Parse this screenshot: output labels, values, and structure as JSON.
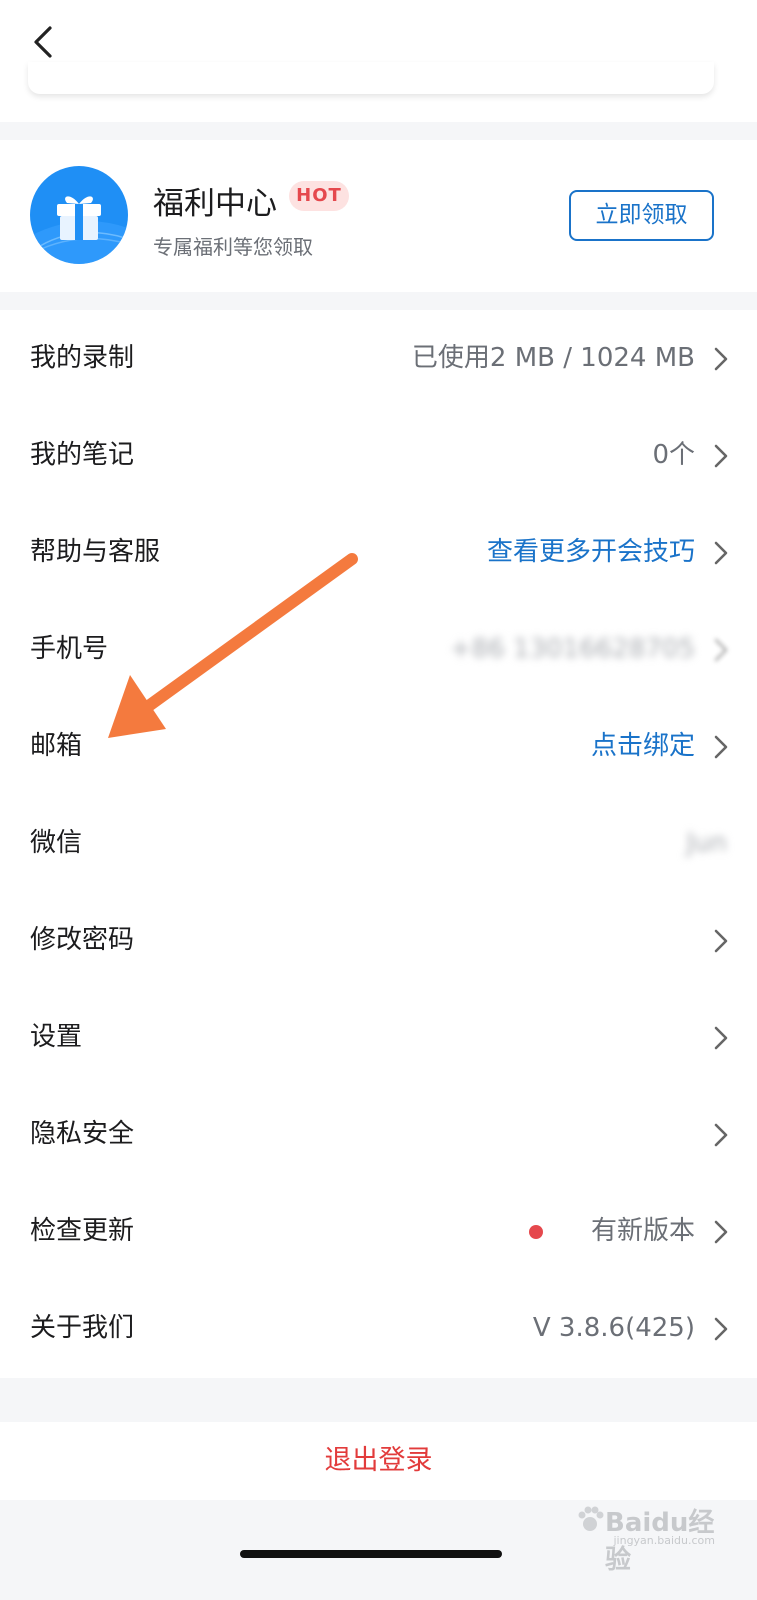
{
  "header": {
    "back_icon": "chevron-left-icon"
  },
  "welfare": {
    "icon": "gift-icon",
    "title": "福利中心",
    "badge": "HOT",
    "subtitle": "专属福利等您领取",
    "button_label": "立即领取",
    "accent_color": "#1a73c9",
    "badge_color": "#e5484d"
  },
  "menu": {
    "items": [
      {
        "label": "我的录制",
        "value": "已使用2 MB / 1024 MB",
        "style": "gray"
      },
      {
        "label": "我的笔记",
        "value": "0个",
        "style": "gray"
      },
      {
        "label": "帮助与客服",
        "value": "查看更多开会技巧",
        "style": "blue"
      },
      {
        "label": "手机号",
        "value": "+86 13016628705",
        "style": "blurred"
      },
      {
        "label": "邮箱",
        "value": "点击绑定",
        "style": "blue"
      },
      {
        "label": "微信",
        "value": "Jun",
        "style": "blurred",
        "no_chevron": true
      },
      {
        "label": "修改密码",
        "value": "",
        "style": "gray"
      },
      {
        "label": "设置",
        "value": "",
        "style": "gray"
      },
      {
        "label": "隐私安全",
        "value": "",
        "style": "gray"
      },
      {
        "label": "检查更新",
        "value": "有新版本",
        "style": "gray",
        "dot": true
      },
      {
        "label": "关于我们",
        "value": "V 3.8.6(425)",
        "style": "gray"
      }
    ]
  },
  "logout": {
    "label": "退出登录",
    "color": "#e23b3b"
  },
  "watermark": {
    "text": "Baidu经验",
    "url_text": "jingyan.baidu.com"
  }
}
